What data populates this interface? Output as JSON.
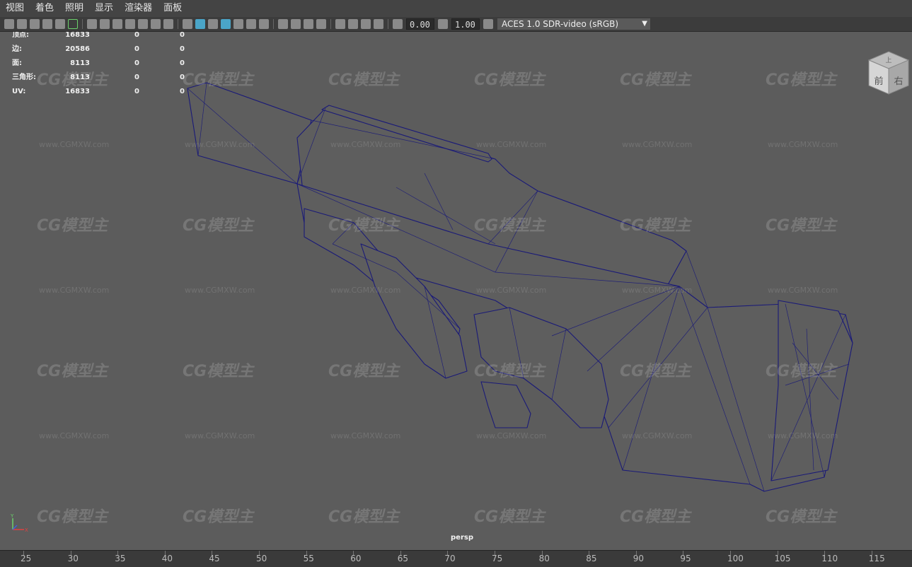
{
  "menu": [
    "视图",
    "着色",
    "照明",
    "显示",
    "渲染器",
    "面板"
  ],
  "toolbar": {
    "exposure": "0.00",
    "gamma": "1.00",
    "color_space": "ACES 1.0 SDR-video (sRGB)"
  },
  "hud": [
    {
      "label": "顶点:",
      "v1": "16833",
      "v2": "0",
      "v3": "0"
    },
    {
      "label": "边:",
      "v1": "20586",
      "v2": "0",
      "v3": "0"
    },
    {
      "label": "面:",
      "v1": "8113",
      "v2": "0",
      "v3": "0"
    },
    {
      "label": "三角形:",
      "v1": "8113",
      "v2": "0",
      "v3": "0"
    },
    {
      "label": "UV:",
      "v1": "16833",
      "v2": "0",
      "v3": "0"
    }
  ],
  "watermark": {
    "logo": "CG模型主",
    "url": "www.CGMXW.com"
  },
  "camera_label": "persp",
  "viewcube": {
    "top": "上",
    "front": "前",
    "right": "右"
  },
  "axis": {
    "y": "Y",
    "x": "X"
  },
  "timeline_ticks": [
    "25",
    "30",
    "35",
    "40",
    "45",
    "50",
    "55",
    "60",
    "65",
    "70",
    "75",
    "80",
    "85",
    "90",
    "95",
    "100",
    "105",
    "110",
    "115"
  ],
  "colors": {
    "wireframe": "#1a1a78",
    "viewport_bg": "#5c5c5c",
    "active_icon": "#4aa5c8"
  }
}
